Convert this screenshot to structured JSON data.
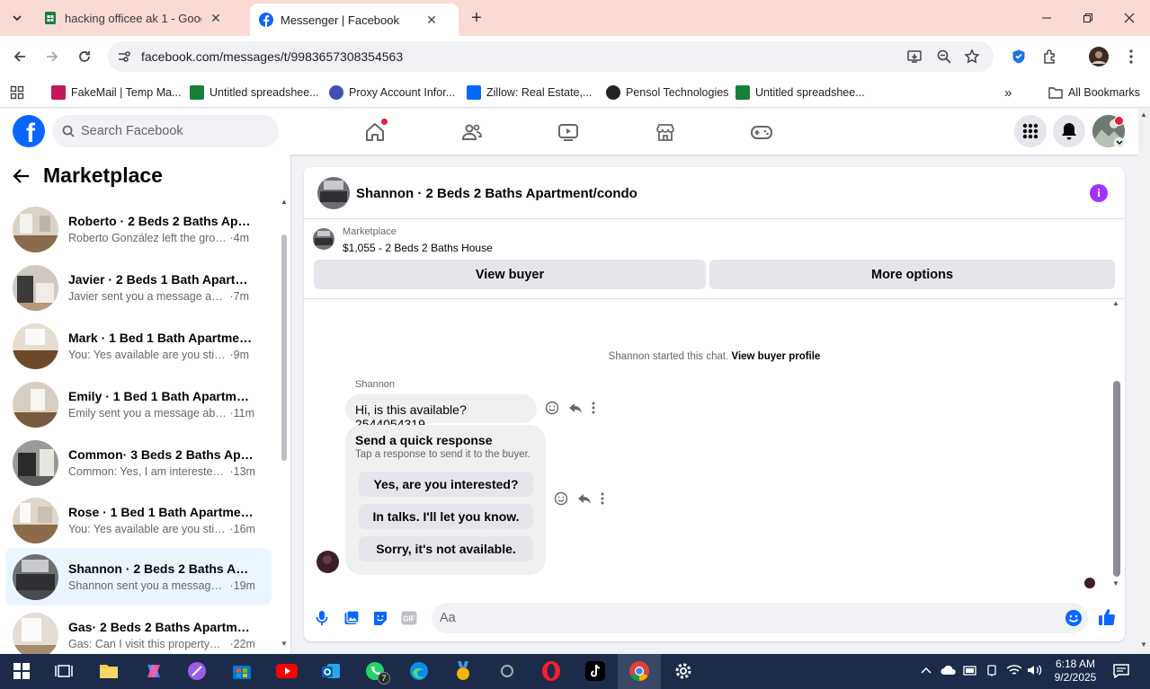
{
  "browser": {
    "tabs": [
      {
        "title": "hacking officee ak 1 - Google Sh",
        "active": false
      },
      {
        "title": "Messenger | Facebook",
        "active": true
      }
    ],
    "url": "facebook.com/messages/t/9983657308354563",
    "bookmarks": [
      "FakeMail | Temp Ma...",
      "Untitled spreadshee...",
      "Proxy Account Infor...",
      "Zillow: Real Estate,...",
      "Pensol Technologies",
      "Untitled spreadshee..."
    ],
    "all_bookmarks": "All Bookmarks"
  },
  "facebook": {
    "search_placeholder": "Search Facebook",
    "brand_color": "#0866ff"
  },
  "marketplace": {
    "title": "Marketplace",
    "conversations": [
      {
        "name": "Roberto · 2 Beds 2 Baths Apart...",
        "preview": "Roberto González left the group.",
        "time": "4m",
        "selected": false
      },
      {
        "name": "Javier · 2 Beds 1 Bath Apartment...",
        "preview": "Javier sent you a message about y...",
        "time": "7m",
        "selected": false
      },
      {
        "name": "Mark · 1 Bed 1 Bath Apartment/...",
        "preview": "You: Yes available are you still inter...",
        "time": "9m",
        "selected": false
      },
      {
        "name": "Emily · 1 Bed 1 Bath Apartment/...",
        "preview": "Emily sent you a message about ...",
        "time": "11m",
        "selected": false
      },
      {
        "name": "Common· 3 Beds 2 Baths Apart...",
        "preview": "Common: Yes, I am interested. M...",
        "time": "13m",
        "selected": false
      },
      {
        "name": "Rose · 1 Bed 1 Bath Apartment/c...",
        "preview": "You: Yes available are you still int...",
        "time": "16m",
        "selected": false
      },
      {
        "name": "Shannon · 2 Beds 2 Baths Apart...",
        "preview": "Shannon sent you a message ab...",
        "time": "19m",
        "selected": true
      },
      {
        "name": "Gas· 2 Beds 2 Baths Apartment/...",
        "preview": "Gas: Can I visit this property? 469...",
        "time": "22m",
        "selected": false
      }
    ]
  },
  "chat": {
    "title": "Shannon · 2 Beds 2 Baths Apartment/condo",
    "listing_label": "Marketplace",
    "listing_price": "$1,055 - 2 Beds 2 Baths House",
    "view_buyer": "View buyer",
    "more_options": "More options",
    "started_text": "Shannon started this chat.",
    "view_buyer_profile": "View buyer profile",
    "sender": "Shannon",
    "message": "Hi, is this available? 2544054319",
    "quick_title": "Send a quick response",
    "quick_sub": "Tap a response to send it to the buyer.",
    "quick_replies": [
      "Yes, are you interested?",
      "In talks. I'll let you know.",
      "Sorry, it's not available."
    ],
    "composer_placeholder": "Aa"
  },
  "taskbar": {
    "time": "6:18 AM",
    "date": "9/2/2025",
    "whatsapp_badge": "7"
  }
}
